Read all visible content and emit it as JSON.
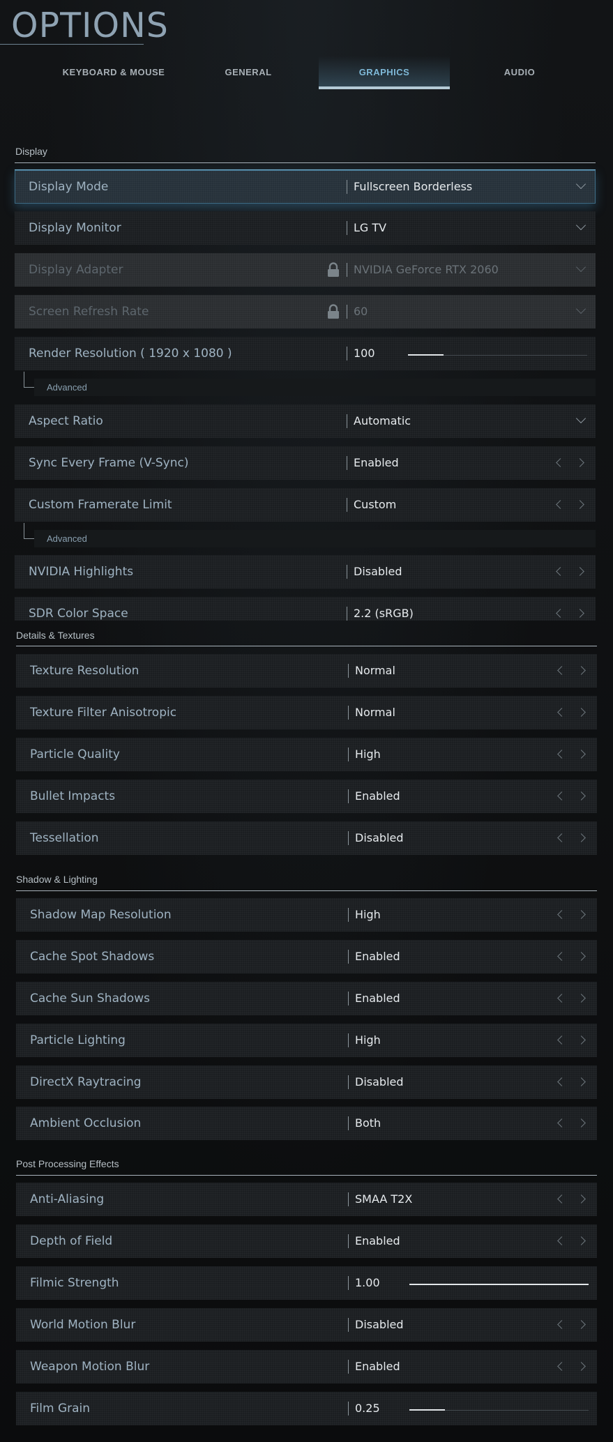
{
  "header": {
    "title": "OPTIONS"
  },
  "tabs": [
    {
      "label": "KEYBOARD & MOUSE",
      "active": false
    },
    {
      "label": "GENERAL",
      "active": false
    },
    {
      "label": "GRAPHICS",
      "active": true
    },
    {
      "label": "AUDIO",
      "active": false
    }
  ],
  "sections": {
    "display": {
      "label": "Display",
      "rows": [
        {
          "label": "Display Mode",
          "value": "Fullscreen Borderless",
          "control": "dropdown",
          "highlighted": true
        },
        {
          "label": "Display Monitor",
          "value": "LG TV",
          "control": "dropdown"
        },
        {
          "label": "Display Adapter",
          "value": "NVIDIA GeForce RTX 2060",
          "control": "dropdown",
          "locked": true
        },
        {
          "label": "Screen Refresh Rate",
          "value": "60",
          "control": "dropdown",
          "locked": true
        },
        {
          "label": "Render Resolution ( 1920 x 1080 )",
          "value": "100",
          "control": "slider",
          "level": 0.2
        },
        {
          "label": "Aspect Ratio",
          "value": "Automatic",
          "control": "dropdown"
        },
        {
          "label": "Sync Every Frame (V-Sync)",
          "value": "Enabled",
          "control": "stepper"
        },
        {
          "label": "Custom Framerate Limit",
          "value": "Custom",
          "control": "stepper"
        },
        {
          "label": "NVIDIA Highlights",
          "value": "Disabled",
          "control": "stepper"
        },
        {
          "label": "SDR Color Space",
          "value": "2.2 (sRGB)",
          "control": "stepper"
        }
      ],
      "advanced_label": "Advanced"
    },
    "details": {
      "label": "Details & Textures",
      "rows": [
        {
          "label": "Texture Resolution",
          "value": "Normal"
        },
        {
          "label": "Texture Filter Anisotropic",
          "value": "Normal"
        },
        {
          "label": "Particle Quality",
          "value": "High"
        },
        {
          "label": "Bullet Impacts",
          "value": "Enabled"
        },
        {
          "label": "Tessellation",
          "value": "Disabled"
        }
      ]
    },
    "shadow": {
      "label": "Shadow & Lighting",
      "rows": [
        {
          "label": "Shadow Map Resolution",
          "value": "High"
        },
        {
          "label": "Cache Spot Shadows",
          "value": "Enabled"
        },
        {
          "label": "Cache Sun Shadows",
          "value": "Enabled"
        },
        {
          "label": "Particle Lighting",
          "value": "High"
        },
        {
          "label": "DirectX Raytracing",
          "value": "Disabled"
        },
        {
          "label": "Ambient Occlusion",
          "value": "Both"
        }
      ]
    },
    "post": {
      "label": "Post Processing Effects",
      "rows": [
        {
          "label": "Anti-Aliasing",
          "value": "SMAA T2X",
          "control": "stepper"
        },
        {
          "label": "Depth of Field",
          "value": "Enabled",
          "control": "stepper"
        },
        {
          "label": "Filmic Strength",
          "value": "1.00",
          "control": "slider",
          "level": 1.0
        },
        {
          "label": "World Motion Blur",
          "value": "Disabled",
          "control": "stepper"
        },
        {
          "label": "Weapon Motion Blur",
          "value": "Enabled",
          "control": "stepper"
        },
        {
          "label": "Film Grain",
          "value": "0.25",
          "control": "slider",
          "level": 0.2
        }
      ]
    }
  },
  "icons": {
    "dropdown": "chevron-down-icon",
    "lock": "lock-icon",
    "left": "chevron-left-icon",
    "right": "chevron-right-icon"
  },
  "colors": {
    "accent": "#7fb9d8",
    "background": "#0d0e10",
    "row": "#1b1e21"
  }
}
